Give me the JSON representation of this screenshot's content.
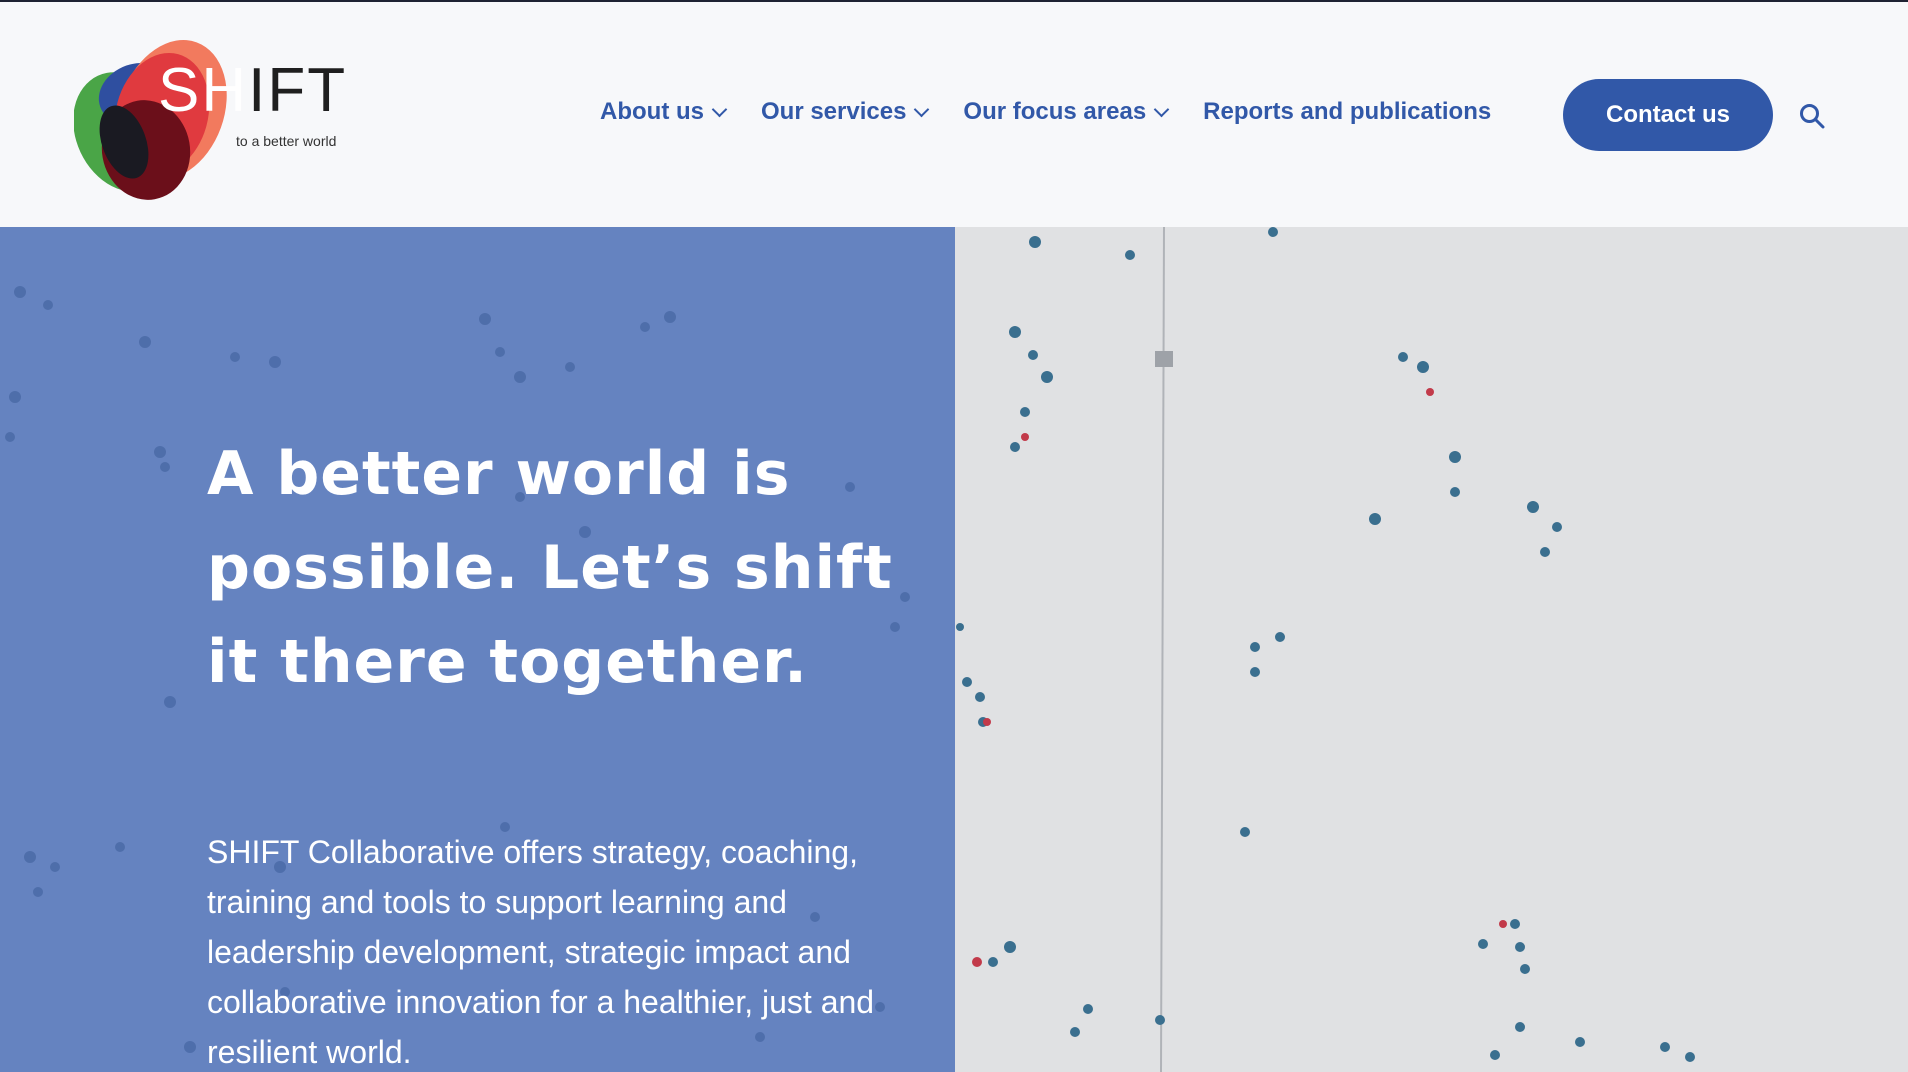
{
  "logo": {
    "word": "SHIFT",
    "word_first": "SH",
    "word_rest": "IFT",
    "tagline": "to a better world"
  },
  "nav": {
    "items": [
      {
        "label": "About us",
        "has_dropdown": true
      },
      {
        "label": "Our services",
        "has_dropdown": true
      },
      {
        "label": "Our focus areas",
        "has_dropdown": true
      },
      {
        "label": "Reports and publications",
        "has_dropdown": false
      }
    ],
    "contact_label": "Contact us",
    "search_icon": "search-icon"
  },
  "hero": {
    "headline": "A better world is possible. Let’s shift it there together.",
    "intro": "SHIFT Collaborative offers strategy, coaching, training and tools to support learning and leadership development, strategic impact and collaborative innovation for a healthier, just and resilient world."
  },
  "colors": {
    "brand_blue": "#3158a8",
    "hero_overlay": "#6583c0",
    "plaza_grey": "#e0e1e3",
    "logo_red": "#e03a3f",
    "logo_coral": "#f27a5e",
    "logo_green": "#4aa547",
    "logo_dark": "#6b0f1a",
    "logo_navy": "#2f4fa0"
  }
}
